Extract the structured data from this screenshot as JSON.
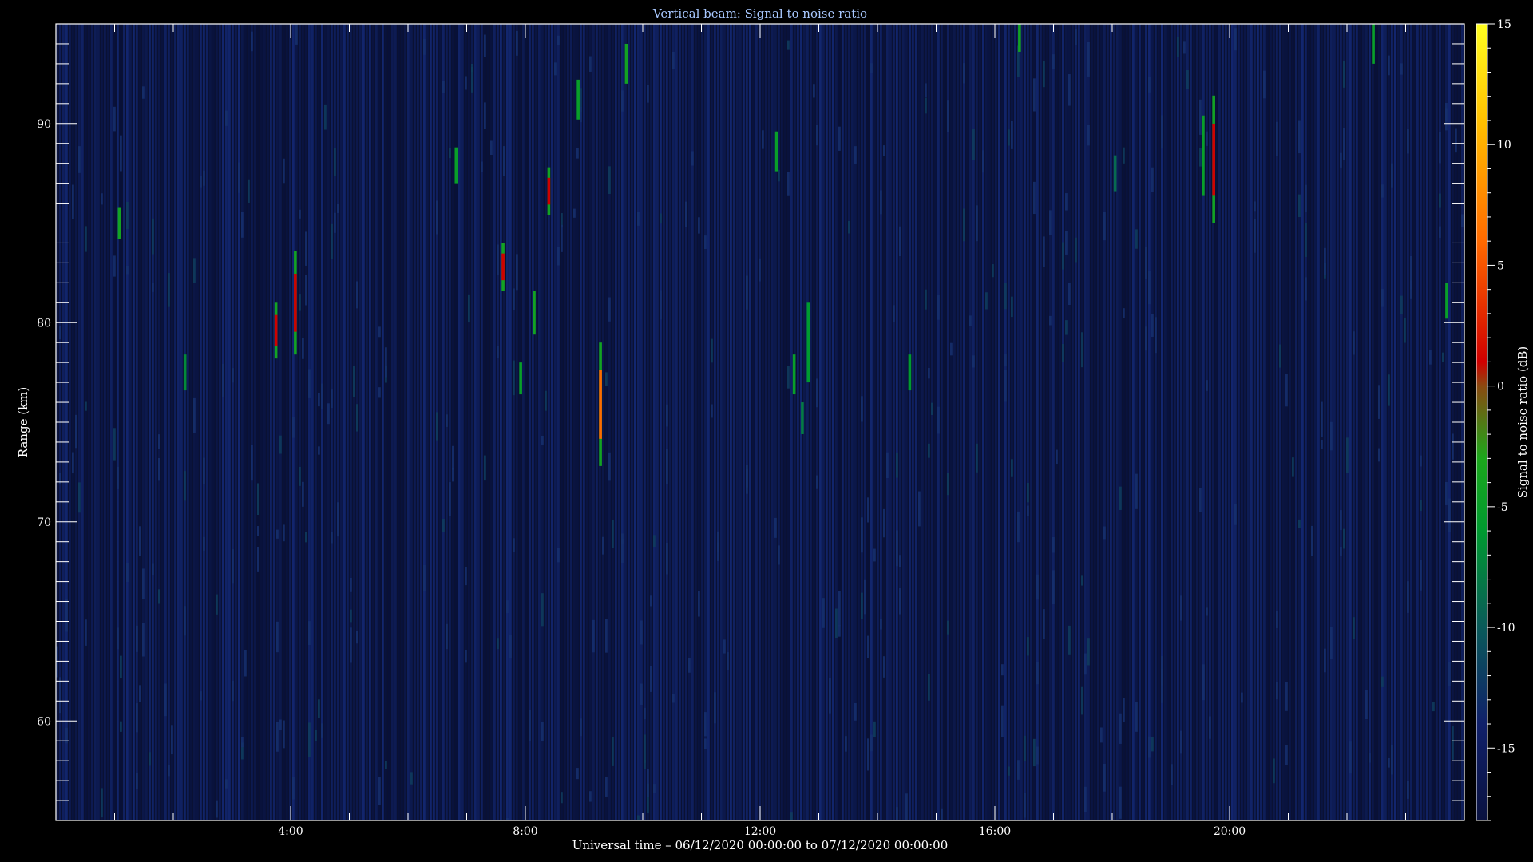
{
  "chart_data": {
    "type": "heatmap",
    "title": "Vertical beam: Signal to noise ratio",
    "xlabel": "Universal time – 06/12/2020 00:00:00 to 07/12/2020 00:00:00",
    "ylabel": "Range (km)",
    "colorbar_label": "Signal to noise ratio (dB)",
    "xlim_hours": [
      0,
      24
    ],
    "ylim_km": [
      55,
      95
    ],
    "clim_db": [
      -18,
      15
    ],
    "x_ticks": [
      {
        "hour": 4,
        "label": "4:00"
      },
      {
        "hour": 8,
        "label": "8:00"
      },
      {
        "hour": 12,
        "label": "12:00"
      },
      {
        "hour": 16,
        "label": "16:00"
      },
      {
        "hour": 20,
        "label": "20:00"
      }
    ],
    "y_ticks": [
      {
        "km": 60,
        "label": "60"
      },
      {
        "km": 70,
        "label": "70"
      },
      {
        "km": 80,
        "label": "80"
      },
      {
        "km": 90,
        "label": "90"
      }
    ],
    "colorbar_ticks": [
      {
        "db": 15,
        "label": "15"
      },
      {
        "db": 10,
        "label": "10"
      },
      {
        "db": 5,
        "label": "5"
      },
      {
        "db": 0,
        "label": "0"
      },
      {
        "db": -5,
        "label": "-5"
      },
      {
        "db": -10,
        "label": "-10"
      },
      {
        "db": -15,
        "label": "-15"
      }
    ],
    "colormap": [
      {
        "db": -18,
        "color": "#0a1240"
      },
      {
        "db": -14,
        "color": "#10206a"
      },
      {
        "db": -10,
        "color": "#0a5a5a"
      },
      {
        "db": -6,
        "color": "#009a30"
      },
      {
        "db": -3,
        "color": "#1ca81c"
      },
      {
        "db": 0,
        "color": "#8a4a10"
      },
      {
        "db": 1,
        "color": "#d00000"
      },
      {
        "db": 6,
        "color": "#ff6a00"
      },
      {
        "db": 11,
        "color": "#ffc000"
      },
      {
        "db": 15,
        "color": "#ffff20"
      }
    ],
    "echoes": [
      {
        "hour": 1.08,
        "km_bottom": 84.2,
        "km_top": 85.8,
        "peak_db": -4
      },
      {
        "hour": 2.2,
        "km_bottom": 76.6,
        "km_top": 78.4,
        "peak_db": -7
      },
      {
        "hour": 3.75,
        "km_bottom": 78.2,
        "km_top": 81.0,
        "peak_db": 1
      },
      {
        "hour": 4.08,
        "km_bottom": 78.4,
        "km_top": 83.6,
        "peak_db": 1
      },
      {
        "hour": 6.82,
        "km_bottom": 87.0,
        "km_top": 88.8,
        "peak_db": -5
      },
      {
        "hour": 7.62,
        "km_bottom": 81.6,
        "km_top": 84.0,
        "peak_db": 1
      },
      {
        "hour": 7.92,
        "km_bottom": 76.4,
        "km_top": 78.0,
        "peak_db": -5
      },
      {
        "hour": 8.15,
        "km_bottom": 79.4,
        "km_top": 81.6,
        "peak_db": -4
      },
      {
        "hour": 8.4,
        "km_bottom": 85.4,
        "km_top": 87.8,
        "peak_db": 1
      },
      {
        "hour": 8.9,
        "km_bottom": 90.2,
        "km_top": 92.2,
        "peak_db": -5
      },
      {
        "hour": 9.28,
        "km_bottom": 72.8,
        "km_top": 79.0,
        "peak_db": 6
      },
      {
        "hour": 9.72,
        "km_bottom": 92.0,
        "km_top": 94.0,
        "peak_db": -4
      },
      {
        "hour": 12.28,
        "km_bottom": 87.6,
        "km_top": 89.6,
        "peak_db": -5
      },
      {
        "hour": 12.58,
        "km_bottom": 76.4,
        "km_top": 78.4,
        "peak_db": -5
      },
      {
        "hour": 12.72,
        "km_bottom": 74.4,
        "km_top": 76.0,
        "peak_db": -8
      },
      {
        "hour": 12.82,
        "km_bottom": 77.0,
        "km_top": 81.0,
        "peak_db": -6
      },
      {
        "hour": 14.55,
        "km_bottom": 76.6,
        "km_top": 78.4,
        "peak_db": -6
      },
      {
        "hour": 16.42,
        "km_bottom": 93.6,
        "km_top": 95.0,
        "peak_db": -4
      },
      {
        "hour": 18.05,
        "km_bottom": 86.6,
        "km_top": 88.4,
        "peak_db": -9
      },
      {
        "hour": 19.55,
        "km_bottom": 86.4,
        "km_top": 90.4,
        "peak_db": -5
      },
      {
        "hour": 19.73,
        "km_bottom": 85.0,
        "km_top": 91.4,
        "peak_db": 1
      },
      {
        "hour": 22.45,
        "km_bottom": 93.0,
        "km_top": 95.0,
        "peak_db": -5
      },
      {
        "hour": 23.7,
        "km_bottom": 80.2,
        "km_top": 82.0,
        "peak_db": -5
      }
    ]
  }
}
